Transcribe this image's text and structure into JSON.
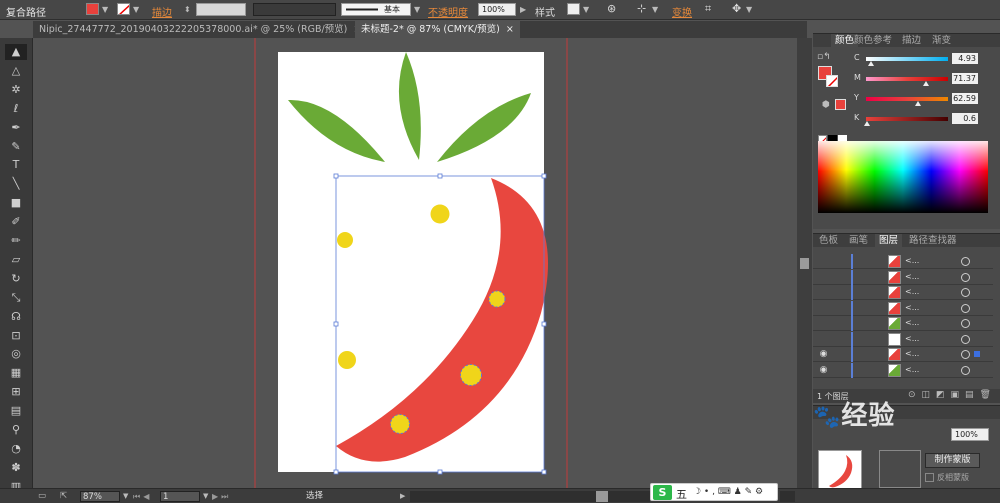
{
  "topbar": {
    "title": "复合路径",
    "stroke_label": "描边",
    "stroke_style": "基本",
    "opacity_label": "不透明度",
    "opacity_value": "100%",
    "style_label": "样式",
    "transform_label": "变换",
    "fill_color": "#e8413c"
  },
  "tabs": [
    {
      "label": "Nipic_27447772_20190403222205378000.ai* @ 25% (RGB/预览)",
      "active": false
    },
    {
      "label": "未标题-2* @ 87% (CMYK/预览)",
      "active": true
    }
  ],
  "tools": [
    {
      "name": "selection-tool",
      "glyph": "▲"
    },
    {
      "name": "direct-selection-tool",
      "glyph": "△"
    },
    {
      "name": "magic-wand-tool",
      "glyph": "✲"
    },
    {
      "name": "lasso-tool",
      "glyph": "ℓ"
    },
    {
      "name": "pen-tool",
      "glyph": "✒"
    },
    {
      "name": "curvature-tool",
      "glyph": "✎"
    },
    {
      "name": "type-tool",
      "glyph": "T"
    },
    {
      "name": "line-tool",
      "glyph": "╲"
    },
    {
      "name": "rectangle-tool",
      "glyph": "■"
    },
    {
      "name": "paintbrush-tool",
      "glyph": "✐"
    },
    {
      "name": "pencil-tool",
      "glyph": "✏"
    },
    {
      "name": "eraser-tool",
      "glyph": "▱"
    },
    {
      "name": "rotate-tool",
      "glyph": "↻"
    },
    {
      "name": "scale-tool",
      "glyph": "⤡"
    },
    {
      "name": "warp-tool",
      "glyph": "☊"
    },
    {
      "name": "free-transform-tool",
      "glyph": "⊡"
    },
    {
      "name": "shape-builder-tool",
      "glyph": "◎"
    },
    {
      "name": "perspective-grid-tool",
      "glyph": "▦"
    },
    {
      "name": "mesh-tool",
      "glyph": "⊞"
    },
    {
      "name": "gradient-tool",
      "glyph": "▤"
    },
    {
      "name": "eyedropper-tool",
      "glyph": "⚲"
    },
    {
      "name": "blend-tool",
      "glyph": "◔"
    },
    {
      "name": "symbol-sprayer-tool",
      "glyph": "✽"
    },
    {
      "name": "graph-tool",
      "glyph": "▥"
    }
  ],
  "color_panel": {
    "tabs": [
      "颜色",
      "颜色参考",
      "描边",
      "渐变"
    ],
    "sliders": [
      {
        "label": "C",
        "value": "4.93",
        "gradient": "linear-gradient(to right,#fff,#00aeef)"
      },
      {
        "label": "M",
        "value": "71.37",
        "gradient": "linear-gradient(to right,#f9c,#e8413c,#c00)"
      },
      {
        "label": "Y",
        "value": "62.59",
        "gradient": "linear-gradient(to right,#e04,#e8413c,#e80)"
      },
      {
        "label": "K",
        "value": "0.6",
        "gradient": "linear-gradient(to right,#e8413c,#400)"
      }
    ],
    "fill_color": "#e8413c"
  },
  "layers_panel": {
    "tabs": [
      "色板",
      "画笔",
      "图层",
      "路径查找器"
    ],
    "rows": [
      {
        "name": "<...",
        "thumb": "#e8413c",
        "visible": false
      },
      {
        "name": "<...",
        "thumb": "#e8413c",
        "visible": false
      },
      {
        "name": "<...",
        "thumb": "#e8413c",
        "visible": false
      },
      {
        "name": "<...",
        "thumb": "#e8413c",
        "visible": false
      },
      {
        "name": "<...",
        "thumb": "#6aaa36",
        "visible": false
      },
      {
        "name": "<...",
        "thumb": "#ffffff",
        "visible": false
      },
      {
        "name": "<...",
        "thumb": "#e8413c",
        "visible": true
      },
      {
        "name": "<...",
        "thumb": "#6aaa36",
        "visible": true
      }
    ],
    "footer": "1 个图层"
  },
  "transparency_panel": {
    "opacity": "100%",
    "mask_button": "制作蒙版",
    "invert_label": "反相蒙版"
  },
  "watermark": "经验",
  "statusbar": {
    "zoom": "87%",
    "page": "1",
    "status": "选择"
  },
  "ime": {
    "logo": "S",
    "mode": "五",
    "icons": "☽ • , ⌨ ♟ ✎ ⚙"
  }
}
